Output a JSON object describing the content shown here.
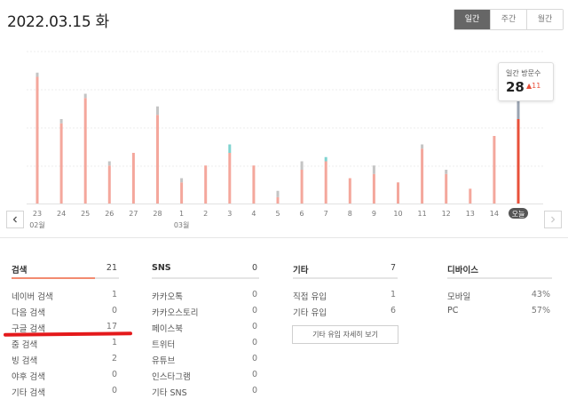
{
  "header": {
    "date": "2022.03.15 화"
  },
  "period_tabs": [
    {
      "label": "일간",
      "active": true
    },
    {
      "label": "주간",
      "active": false
    },
    {
      "label": "월간",
      "active": false
    }
  ],
  "tooltip": {
    "label": "일간 방문수",
    "value": "28",
    "delta": "▲11"
  },
  "nav": {
    "prev_icon": "chevron-left-icon",
    "next_icon": "chevron-right-icon"
  },
  "chart_data": {
    "type": "bar",
    "categories": [
      "23",
      "24",
      "25",
      "26",
      "27",
      "28",
      "1",
      "2",
      "3",
      "4",
      "5",
      "6",
      "7",
      "8",
      "9",
      "10",
      "11",
      "12",
      "13",
      "14",
      "오늘"
    ],
    "month_labels": [
      {
        "label": "02월",
        "at": "23"
      },
      {
        "label": "03월",
        "at": "1"
      }
    ],
    "ylim": [
      0,
      36
    ],
    "series": [
      {
        "color": "#f4a79c",
        "values": [
          30,
          19,
          25,
          9,
          12,
          21,
          5,
          9,
          12,
          9,
          1.5,
          8,
          10,
          6,
          7,
          5,
          13,
          7,
          3.5,
          16,
          0
        ]
      },
      {
        "color": "#c4c4c4",
        "values": [
          1,
          1,
          1,
          1,
          0,
          2,
          1,
          0,
          0,
          0,
          1.5,
          2,
          0,
          0,
          2,
          0,
          1,
          1,
          0,
          0,
          0
        ]
      },
      {
        "color": "#7fd3cf",
        "values": [
          0,
          0,
          0,
          0,
          0,
          0,
          0,
          0,
          2,
          0,
          0,
          0,
          1,
          0,
          0,
          0,
          0,
          0,
          0,
          0,
          0
        ]
      },
      {
        "color": "#e8503a",
        "values": [
          0,
          0,
          0,
          0,
          0,
          0,
          0,
          0,
          0,
          0,
          0,
          0,
          0,
          0,
          0,
          0,
          0,
          0,
          0,
          0,
          20
        ]
      },
      {
        "color": "#9aa3b1",
        "values": [
          0,
          0,
          0,
          0,
          0,
          0,
          0,
          0,
          0,
          0,
          0,
          0,
          0,
          0,
          0,
          0,
          0,
          0,
          0,
          0,
          7
        ]
      }
    ],
    "today_badge_color": "#555555"
  },
  "stats": [
    {
      "title": "검색",
      "total": "21",
      "accent": "#f28b70",
      "fill": 0.78,
      "rows": [
        {
          "label": "네이버 검색",
          "value": "1"
        },
        {
          "label": "다음 검색",
          "value": "0"
        },
        {
          "label": "구글 검색",
          "value": "17"
        },
        {
          "label": "줌 검색",
          "value": "1"
        },
        {
          "label": "빙 검색",
          "value": "2"
        },
        {
          "label": "야후 검색",
          "value": "0"
        },
        {
          "label": "기타 검색",
          "value": "0"
        }
      ]
    },
    {
      "title": "SNS",
      "total": "0",
      "accent": "#cfcfcf",
      "fill": 0.0,
      "rows": [
        {
          "label": "카카오톡",
          "value": "0"
        },
        {
          "label": "카카오스토리",
          "value": "0"
        },
        {
          "label": "페이스북",
          "value": "0"
        },
        {
          "label": "트위터",
          "value": "0"
        },
        {
          "label": "유튜브",
          "value": "0"
        },
        {
          "label": "인스타그램",
          "value": "0"
        },
        {
          "label": "기타 SNS",
          "value": "0"
        }
      ]
    },
    {
      "title": "기타",
      "total": "7",
      "accent": "#9aa3b1",
      "fill": 0.0,
      "rows": [
        {
          "label": "직접 유입",
          "value": "1"
        },
        {
          "label": "기타 유입",
          "value": "6"
        }
      ],
      "button": "기타 유입 자세히 보기"
    },
    {
      "title": "디바이스",
      "total": "",
      "accent": "#e5e5e5",
      "fill": 0.0,
      "rows": [
        {
          "label": "모바일",
          "value": "43%"
        },
        {
          "label": "PC",
          "value": "57%"
        }
      ]
    }
  ],
  "annotation": {
    "color": "#e4191b"
  }
}
